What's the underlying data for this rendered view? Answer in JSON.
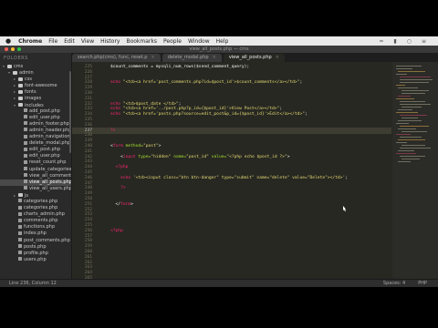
{
  "menu": {
    "app": "Chrome",
    "items": [
      "File",
      "Edit",
      "View",
      "History",
      "Bookmarks",
      "People",
      "Window",
      "Help"
    ]
  },
  "window": {
    "title": "view_all_posts.php — cms"
  },
  "sidebar": {
    "header": "FOLDERS",
    "items": [
      {
        "label": "cms",
        "type": "folder",
        "depth": 0,
        "open": true
      },
      {
        "label": "admin",
        "type": "folder",
        "depth": 1,
        "open": true
      },
      {
        "label": "css",
        "type": "folder",
        "depth": 2,
        "open": false
      },
      {
        "label": "font-awesome",
        "type": "folder",
        "depth": 2,
        "open": false
      },
      {
        "label": "fonts",
        "type": "folder",
        "depth": 2,
        "open": false
      },
      {
        "label": "images",
        "type": "folder",
        "depth": 2,
        "open": false
      },
      {
        "label": "includes",
        "type": "folder",
        "depth": 2,
        "open": true
      },
      {
        "label": "add_post.php",
        "type": "file",
        "depth": 3
      },
      {
        "label": "edit_user.php",
        "type": "file",
        "depth": 3
      },
      {
        "label": "admin_footer.php",
        "type": "file",
        "depth": 3
      },
      {
        "label": "admin_header.php",
        "type": "file",
        "depth": 3
      },
      {
        "label": "admin_navigation",
        "type": "file",
        "depth": 3
      },
      {
        "label": "delete_modal.php",
        "type": "file",
        "depth": 3
      },
      {
        "label": "edit_post.php",
        "type": "file",
        "depth": 3
      },
      {
        "label": "edit_user.php",
        "type": "file",
        "depth": 3
      },
      {
        "label": "reset_count.php",
        "type": "file",
        "depth": 3
      },
      {
        "label": "update_categories",
        "type": "file",
        "depth": 3
      },
      {
        "label": "view_all_comments",
        "type": "file",
        "depth": 3
      },
      {
        "label": "view_all_posts.php",
        "type": "file",
        "depth": 3,
        "selected": true
      },
      {
        "label": "view_all_users.php",
        "type": "file",
        "depth": 3
      },
      {
        "label": "js",
        "type": "folder",
        "depth": 2,
        "open": false
      },
      {
        "label": "categories.php",
        "type": "file",
        "depth": 2
      },
      {
        "label": "categories.php",
        "type": "file",
        "depth": 2
      },
      {
        "label": "charts_admin.php",
        "type": "file",
        "depth": 2
      },
      {
        "label": "comments.php",
        "type": "file",
        "depth": 2
      },
      {
        "label": "functions.php",
        "type": "file",
        "depth": 2
      },
      {
        "label": "index.php",
        "type": "file",
        "depth": 2
      },
      {
        "label": "post_comments.php",
        "type": "file",
        "depth": 2
      },
      {
        "label": "posts.php",
        "type": "file",
        "depth": 2
      },
      {
        "label": "profile.php",
        "type": "file",
        "depth": 2
      },
      {
        "label": "users.php",
        "type": "file",
        "depth": 2
      }
    ]
  },
  "tabs": [
    {
      "label": "search.php(cms), func, reset.p",
      "active": false
    },
    {
      "label": "delete_modal.php",
      "active": false
    },
    {
      "label": "view_all_posts.php",
      "active": true
    }
  ],
  "editor": {
    "lines": [
      {
        "n": "225",
        "segs": [
          [
            "$count_comments = mysqli_num_rows($send_comment_query);",
            "x"
          ]
        ]
      },
      {
        "n": "226",
        "segs": []
      },
      {
        "n": "227",
        "segs": []
      },
      {
        "n": "228",
        "segs": [
          [
            "echo ",
            "k"
          ],
          [
            "\"<td><a href='post_comments.php?id=$post_id'>$count_comments</a></td>\"",
            "s"
          ],
          [
            ";",
            "x"
          ]
        ]
      },
      {
        "n": "229",
        "segs": []
      },
      {
        "n": "230",
        "segs": []
      },
      {
        "n": "231",
        "segs": []
      },
      {
        "n": "232",
        "segs": [
          [
            "echo ",
            "k"
          ],
          [
            "\"<td>$post_date </td>\"",
            "s"
          ],
          [
            ";",
            "x"
          ]
        ]
      },
      {
        "n": "233",
        "segs": [
          [
            "echo ",
            "k"
          ],
          [
            "\"<td><a href='../post.php?p_id={$post_id}'>View Post</a></td>\"",
            "s"
          ],
          [
            ";",
            "x"
          ]
        ]
      },
      {
        "n": "234",
        "segs": [
          [
            "echo ",
            "k"
          ],
          [
            "\"<td><a href='posts.php?source=edit_post&p_id={$post_id}'>Edit</a></td>\"",
            "s"
          ],
          [
            ";",
            "x"
          ]
        ]
      },
      {
        "n": "235",
        "segs": []
      },
      {
        "n": "236",
        "segs": []
      },
      {
        "n": "237",
        "segs": [
          [
            "?>",
            "k"
          ]
        ]
      },
      {
        "n": "238",
        "segs": []
      },
      {
        "n": "239",
        "segs": []
      },
      {
        "n": "240",
        "segs": [
          [
            "<",
            "x"
          ],
          [
            "form",
            "t"
          ],
          [
            " method=",
            "a"
          ],
          [
            "\"post\"",
            "s"
          ],
          [
            ">",
            "x"
          ]
        ]
      },
      {
        "n": "241",
        "segs": []
      },
      {
        "n": "242",
        "segs": [
          [
            "    <",
            "x"
          ],
          [
            "input",
            "t"
          ],
          [
            " type=",
            "a"
          ],
          [
            "\"hidden\"",
            "s"
          ],
          [
            " name=",
            "a"
          ],
          [
            "\"post_id\"",
            "s"
          ],
          [
            " value=",
            "a"
          ],
          [
            "\"<?php echo $post_id ?>\"",
            "s"
          ],
          [
            ">",
            "x"
          ]
        ]
      },
      {
        "n": "243",
        "segs": []
      },
      {
        "n": "244",
        "segs": [
          [
            "  <?php",
            "k"
          ]
        ]
      },
      {
        "n": "245",
        "segs": []
      },
      {
        "n": "246",
        "segs": [
          [
            "    echo ",
            "k"
          ],
          [
            "'<td><input class=\"btn btn-danger\" type=\"submit\" name=\"delete\" value=\"Delete\"></td>'",
            "s"
          ],
          [
            ";",
            "x"
          ]
        ]
      },
      {
        "n": "247",
        "segs": []
      },
      {
        "n": "248",
        "segs": [
          [
            "    ?>",
            "k"
          ]
        ]
      },
      {
        "n": "249",
        "segs": []
      },
      {
        "n": "250",
        "segs": []
      },
      {
        "n": "251",
        "segs": [
          [
            "  </",
            "x"
          ],
          [
            "form",
            "t"
          ],
          [
            ">",
            "x"
          ]
        ]
      },
      {
        "n": "252",
        "segs": []
      },
      {
        "n": "253",
        "segs": []
      },
      {
        "n": "254",
        "segs": []
      },
      {
        "n": "255",
        "segs": []
      },
      {
        "n": "256",
        "segs": [
          [
            "<?php",
            "k"
          ]
        ]
      },
      {
        "n": "257",
        "segs": []
      },
      {
        "n": "258",
        "segs": []
      },
      {
        "n": "259",
        "segs": []
      },
      {
        "n": "260",
        "segs": []
      },
      {
        "n": "261",
        "segs": []
      },
      {
        "n": "262",
        "segs": []
      },
      {
        "n": "263",
        "segs": []
      },
      {
        "n": "264",
        "segs": []
      },
      {
        "n": "265",
        "segs": []
      },
      {
        "n": "266",
        "segs": []
      }
    ],
    "current_line": 12
  },
  "status": {
    "position": "Line 236, Column 12",
    "spaces": "Spaces: 4",
    "syntax": "PHP"
  },
  "colors": {
    "editor_bg": "#272822",
    "keyword": "#f92672",
    "string": "#e6db74",
    "attribute": "#a6e22e"
  }
}
